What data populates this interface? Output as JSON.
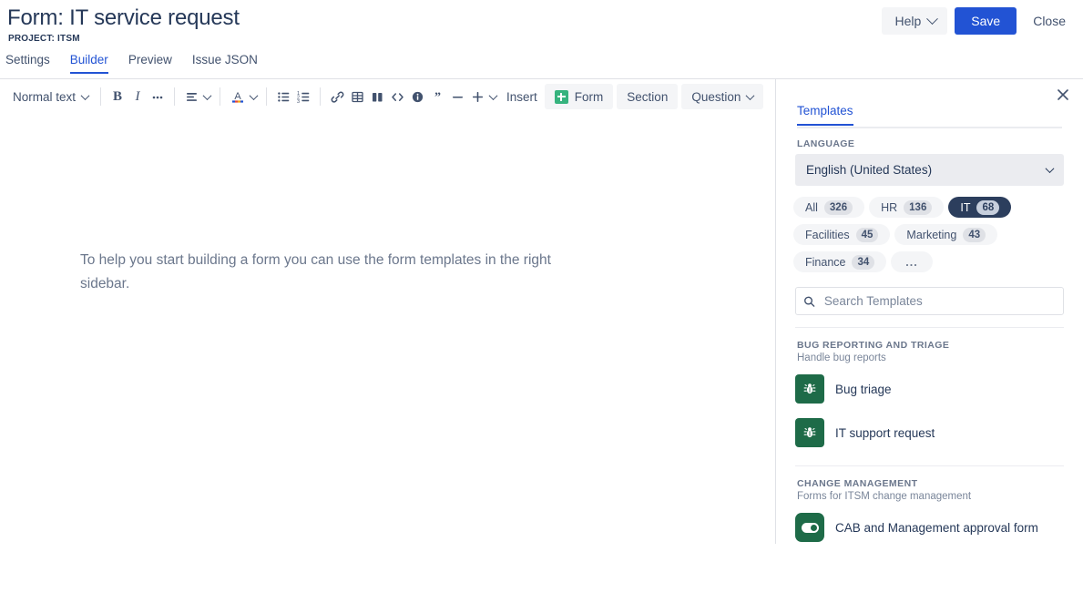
{
  "header": {
    "title": "Form: IT service request",
    "subtitle": "PROJECT: ITSM",
    "help_label": "Help",
    "save_label": "Save",
    "close_label": "Close"
  },
  "tabs": [
    {
      "label": "Settings",
      "active": false
    },
    {
      "label": "Builder",
      "active": true
    },
    {
      "label": "Preview",
      "active": false
    },
    {
      "label": "Issue JSON",
      "active": false
    }
  ],
  "toolbar": {
    "text_style": "Normal text",
    "bold": "B",
    "italic": "I",
    "more_marks": "•••",
    "insert_label": "Insert",
    "form_label": "Form",
    "section_label": "Section",
    "question_label": "Question",
    "icons": [
      "align-left-icon",
      "text-color-icon",
      "bullet-list-icon",
      "numbered-list-icon",
      "link-icon",
      "table-icon",
      "layout-icon",
      "code-icon",
      "info-panel-icon",
      "quote-icon",
      "divider-icon",
      "plus-icon"
    ]
  },
  "editor": {
    "body_text": "To help you start building a form you can use the form templates in the right sidebar."
  },
  "sidebar": {
    "tab_label": "Templates",
    "language_label": "LANGUAGE",
    "language_value": "English (United States)",
    "filters": [
      {
        "label": "All",
        "count": "326",
        "selected": false
      },
      {
        "label": "HR",
        "count": "136",
        "selected": false
      },
      {
        "label": "IT",
        "count": "68",
        "selected": true
      },
      {
        "label": "Facilities",
        "count": "45",
        "selected": false
      },
      {
        "label": "Marketing",
        "count": "43",
        "selected": false
      },
      {
        "label": "Finance",
        "count": "34",
        "selected": false
      },
      {
        "label": "...",
        "count": "",
        "selected": false
      }
    ],
    "search_placeholder": "Search Templates",
    "search_value": "",
    "groups": [
      {
        "title": "BUG REPORTING AND TRIAGE",
        "description": "Handle bug reports",
        "templates": [
          {
            "name": "Bug triage",
            "icon": "bug-icon"
          },
          {
            "name": "IT support request",
            "icon": "bug-icon"
          }
        ]
      },
      {
        "title": "CHANGE MANAGEMENT",
        "description": "Forms for ITSM change management",
        "templates": [
          {
            "name": "CAB and Management approval form",
            "icon": "toggle-icon"
          }
        ]
      }
    ]
  },
  "colors": {
    "accent_blue": "#2253d4",
    "green": "#36b37e",
    "tile_green": "#1e6b48",
    "chip_selected": "#2c3e5d"
  }
}
